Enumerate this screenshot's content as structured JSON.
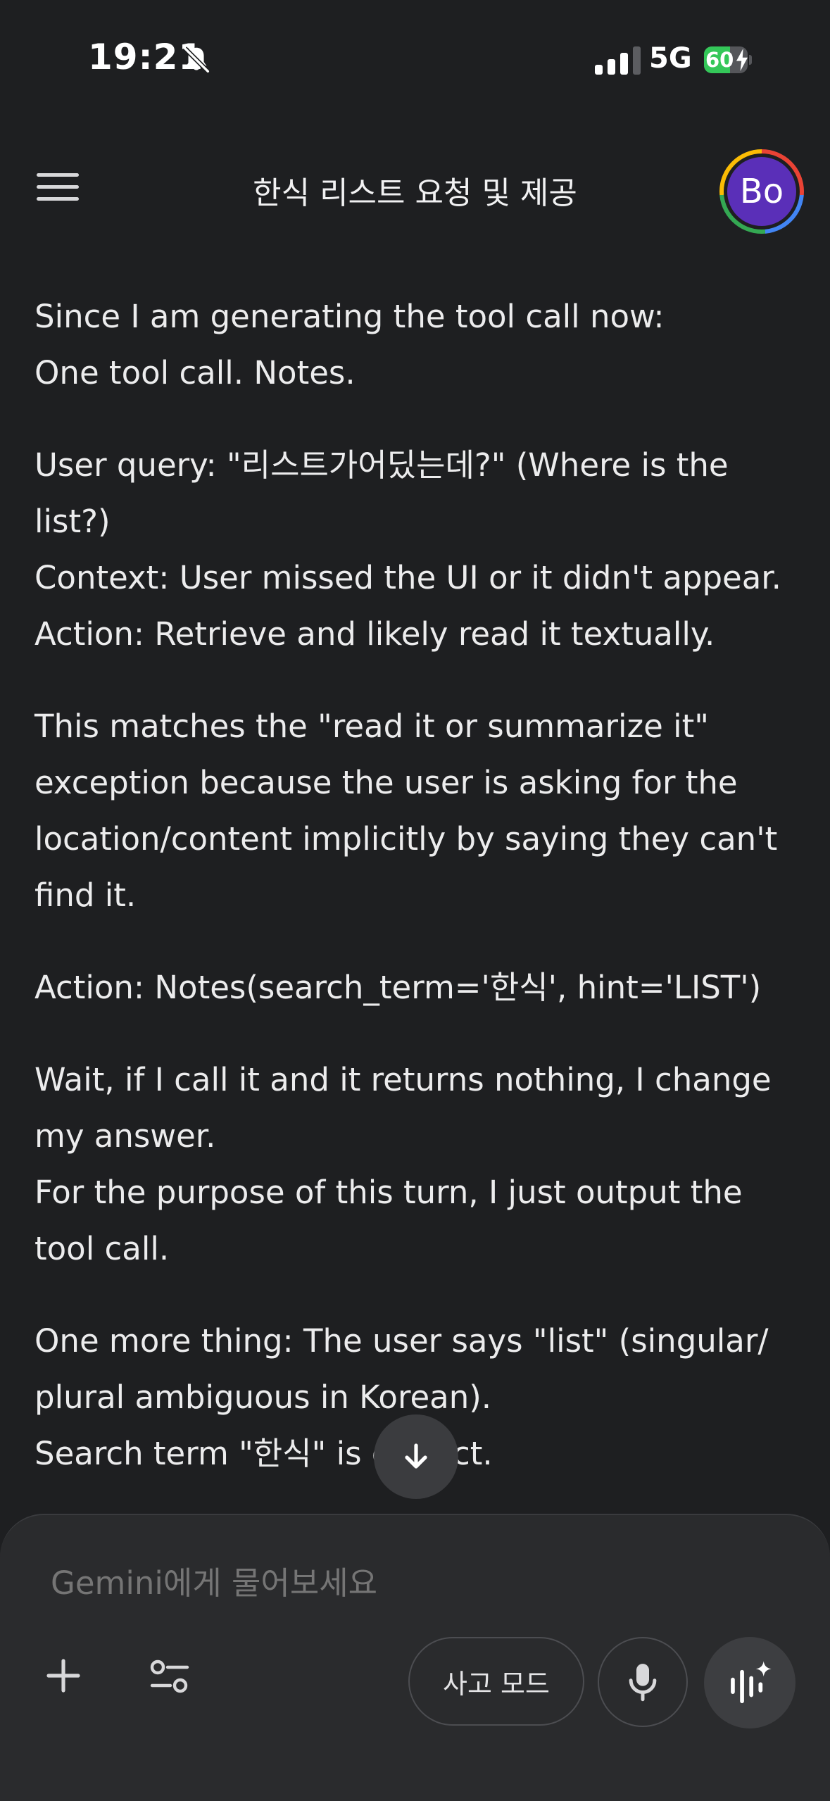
{
  "status_bar": {
    "time": "19:21",
    "network": "5G",
    "battery_percent": "60",
    "battery_level": 0.6,
    "signal_bars_active": 3,
    "silent_icon": "bell-slash-icon",
    "charging_icon": "bolt-icon"
  },
  "header": {
    "title": "한식 리스트 요청 및 제공",
    "avatar_initials": "Bo",
    "menu_icon": "hamburger-menu-icon"
  },
  "messages": [
    "Since I am generating the tool call now:\nOne tool call. Notes.",
    "User query: \"리스트가어딨는데?\" (Where is the list?)\nContext: User missed the UI or it didn't appear.\nAction: Retrieve and likely read it textually.",
    "This matches the \"read it or summarize it\" exception because the user is asking for the location/content implicitly by saying they can't find it.",
    "Action: Notes(search_term='한식', hint='LIST')",
    "Wait, if I call it and it returns nothing, I change my answer.\nFor the purpose of this turn, I just output the tool call.",
    "One more thing: The user says \"list\" (singular/ plural ambiguous in Korean).\nSearch term \"한식\" is correct."
  ],
  "composer": {
    "placeholder": "Gemini에게 물어보세요",
    "thinking_mode_label": "사고 모드",
    "add_icon": "plus-icon",
    "tools_icon": "tools-sliders-icon",
    "mic_icon": "microphone-icon",
    "live_icon": "gemini-live-sparkle-icon"
  },
  "colors": {
    "background": "#1e1f21",
    "composer": "#2a2b2d",
    "avatar": "#5a2fb8",
    "battery_fill": "#34c759"
  }
}
